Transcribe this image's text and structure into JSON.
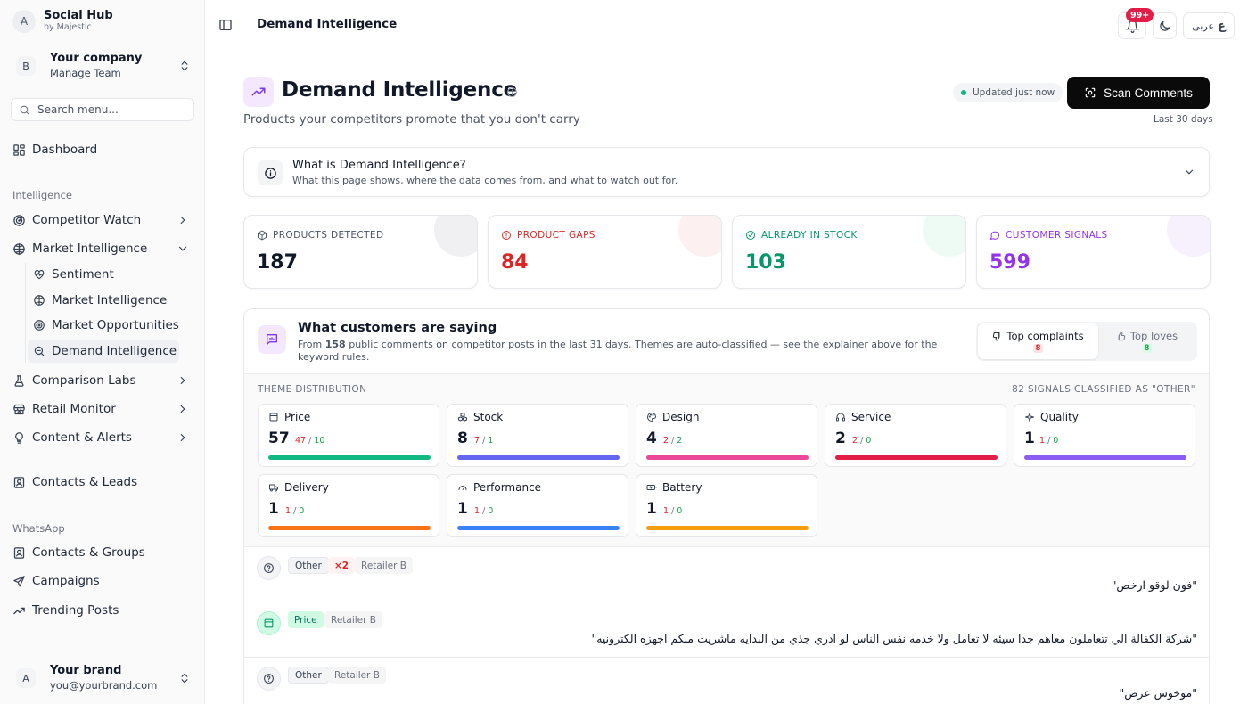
{
  "app": {
    "logo_letter": "A",
    "name": "Social Hub",
    "by": "by Majestic"
  },
  "company": {
    "letter": "B",
    "name": "Your company",
    "sub": "Manage Team"
  },
  "search": {
    "placeholder": "Search menu..."
  },
  "nav": {
    "dashboard": "Dashboard",
    "section_intelligence": "Intelligence",
    "competitor_watch": "Competitor Watch",
    "market_intelligence": "Market Intelligence",
    "sub_items": [
      "Sentiment",
      "Market Intelligence",
      "Market Opportunities",
      "Demand Intelligence"
    ],
    "comparison_labs": "Comparison Labs",
    "retail_monitor": "Retail Monitor",
    "content_alerts": "Content & Alerts",
    "contacts_leads": "Contacts & Leads",
    "section_whatsapp": "WhatsApp",
    "contacts_groups": "Contacts & Groups",
    "campaigns": "Campaigns",
    "trending_posts": "Trending Posts"
  },
  "user": {
    "letter": "A",
    "name": "Your brand",
    "email": "you@yourbrand.com"
  },
  "topbar": {
    "title": "Demand Intelligence",
    "notif_badge": "99+",
    "lang_label": "عربى",
    "lang_glyph": "ع"
  },
  "header": {
    "title": "Demand Intelligence",
    "subtitle": "Products your competitors promote that you don't carry",
    "updated": "Updated just now",
    "scan_label": "Scan Comments",
    "range": "Last 30 days"
  },
  "explainer": {
    "title": "What is Demand Intelligence?",
    "subtitle": "What this page shows, where the data comes from, and what to watch out for."
  },
  "stats": [
    {
      "label": "PRODUCTS DETECTED",
      "value": "187",
      "color": "#111827",
      "label_color": "#4b5563",
      "blob": "#f0f0f2"
    },
    {
      "label": "PRODUCT GAPS",
      "value": "84",
      "color": "#dc2626",
      "label_color": "#dc2626",
      "blob": "#fdf0f0"
    },
    {
      "label": "ALREADY IN STOCK",
      "value": "103",
      "color": "#059669",
      "label_color": "#059669",
      "blob": "#eefaf4"
    },
    {
      "label": "CUSTOMER SIGNALS",
      "value": "599",
      "color": "#9333ea",
      "label_color": "#9333ea",
      "blob": "#f7f0fd"
    }
  ],
  "voice": {
    "title": "What customers are saying",
    "sub_pre": "From ",
    "sub_count": "158",
    "sub_post": " public comments on competitor posts in the last 31 days. Themes are auto-classified — see the explainer above for the keyword rules.",
    "tab_complaints": "Top complaints",
    "complaints_count": "8",
    "tab_loves": "Top loves",
    "loves_count": "8",
    "dist_label": "THEME DISTRIBUTION",
    "other_label": "82 SIGNALS CLASSIFIED AS \"OTHER\""
  },
  "themes": [
    {
      "name": "Price",
      "icon": "tag-icon",
      "count": "57",
      "neg": "47",
      "pos": "10",
      "color": "#10b981"
    },
    {
      "name": "Stock",
      "icon": "boxes-icon",
      "count": "8",
      "neg": "7",
      "pos": "1",
      "color": "#6366f1"
    },
    {
      "name": "Design",
      "icon": "palette-icon",
      "count": "4",
      "neg": "2",
      "pos": "2",
      "color": "#ec4899"
    },
    {
      "name": "Service",
      "icon": "headset-icon",
      "count": "2",
      "neg": "2",
      "pos": "0",
      "color": "#e11d48"
    },
    {
      "name": "Quality",
      "icon": "sparkle-icon",
      "count": "1",
      "neg": "1",
      "pos": "0",
      "color": "#8b5cf6"
    },
    {
      "name": "Delivery",
      "icon": "truck-icon",
      "count": "1",
      "neg": "1",
      "pos": "0",
      "color": "#f97316"
    },
    {
      "name": "Performance",
      "icon": "gauge-icon",
      "count": "1",
      "neg": "1",
      "pos": "0",
      "color": "#3b82f6"
    },
    {
      "name": "Battery",
      "icon": "battery-icon",
      "count": "1",
      "neg": "1",
      "pos": "0",
      "color": "#f59e0b"
    }
  ],
  "comments": [
    {
      "theme": "Other",
      "multiplier": "×2",
      "retailer": "Retailer B",
      "text": "\"فون لوقو ارخص\""
    },
    {
      "theme": "Price",
      "retailer": "Retailer B",
      "text": "\"شركة الكفالة الي تتعاملون معاهم جدا سيئه لا تعامل ولا خدمه نفس الناس لو ادري جذي من البدايه ماشريت منكم اجهزه الكترونيه\""
    },
    {
      "theme": "Other",
      "retailer": "Retailer B",
      "text": "\"موخوش عرض\""
    }
  ]
}
